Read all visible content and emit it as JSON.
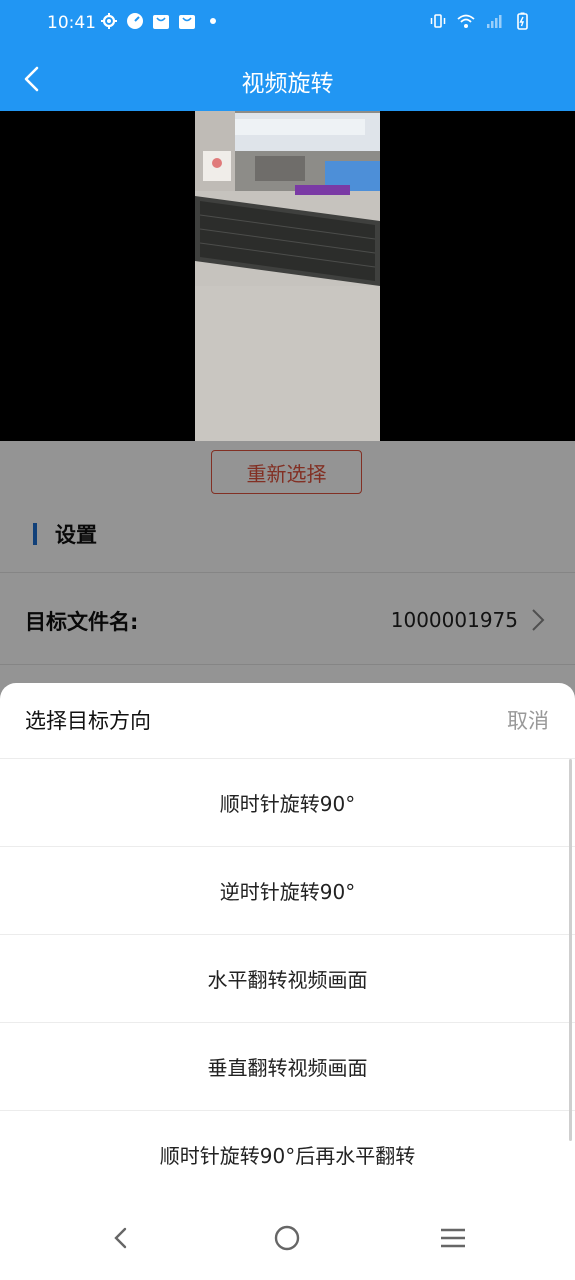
{
  "status_bar": {
    "time": "10:41"
  },
  "app_bar": {
    "title": "视频旋转"
  },
  "actions": {
    "reselect_label": "重新选择"
  },
  "settings": {
    "section_title": "设置",
    "target_filename_label": "目标文件名:",
    "target_filename_value": "1000001975"
  },
  "sheet": {
    "title": "选择目标方向",
    "cancel_label": "取消",
    "options": [
      "顺时针旋转90°",
      "逆时针旋转90°",
      "水平翻转视频画面",
      "垂直翻转视频画面",
      "顺时针旋转90°后再水平翻转"
    ]
  },
  "colors": {
    "primary": "#2196F3",
    "accent_red": "#e0533f",
    "section_bar": "#1e6fd0"
  }
}
